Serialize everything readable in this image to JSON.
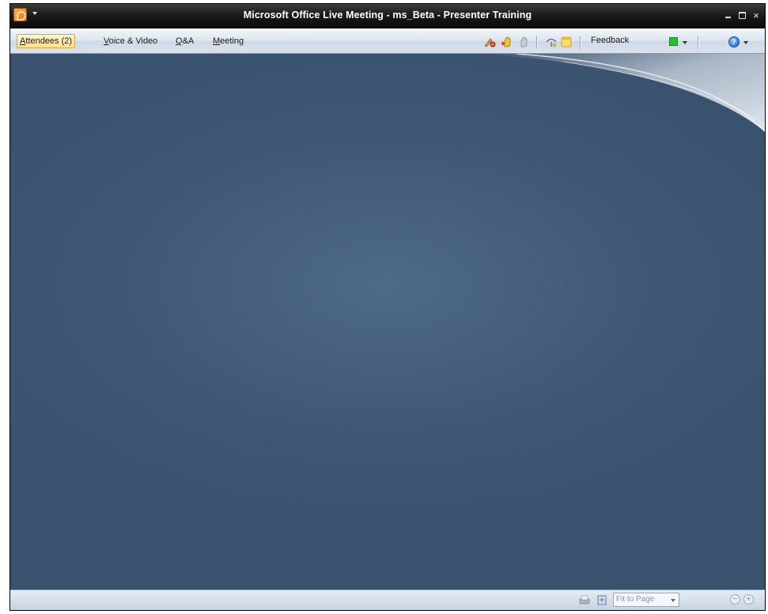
{
  "window": {
    "title": "Microsoft Office Live Meeting - ms_Beta - Presenter Training",
    "controls": {
      "close": "×"
    }
  },
  "menubar": {
    "items": [
      {
        "label_underlined": "A",
        "label_rest": "ttendees (2)",
        "active": true
      },
      {
        "label_underlined": "V",
        "label_rest": "oice & Video",
        "active": false
      },
      {
        "label_underlined": "Q",
        "label_rest": "&A",
        "active": false
      },
      {
        "label_underlined": "M",
        "label_rest": "eeting",
        "active": false
      }
    ],
    "toolbar_icons": [
      "attendee-permissions-icon",
      "raise-hand-icon",
      "cancel-hand-icon",
      "lobby-icon",
      "notes-icon"
    ],
    "feedback": {
      "label": "Feedback",
      "color": "#22c02a"
    },
    "help": {
      "glyph": "?"
    }
  },
  "statusbar": {
    "zoom": {
      "value": "Fit to Page"
    },
    "zoom_out_glyph": "−",
    "zoom_in_glyph": "+"
  },
  "colors": {
    "stage_center": "#4f6a86",
    "stage_edge": "#39526d",
    "titlebar": "#161616",
    "menubar": "#dde5ef"
  }
}
